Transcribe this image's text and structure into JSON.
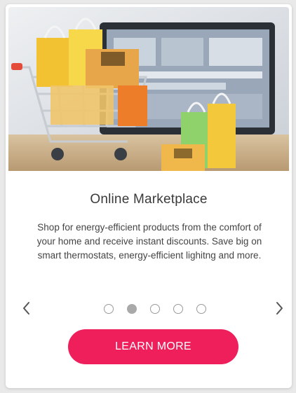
{
  "card": {
    "image": {
      "icon": "shopping-cart-with-bags-and-laptop-photo"
    },
    "title": "Online Marketplace",
    "description": "Shop for energy-efficient products from the comfort of your home and receive instant discounts. Save big on smart thermostats, energy-efficient lighitng and more.",
    "carousel": {
      "prev_icon": "chevron-left-icon",
      "next_icon": "chevron-right-icon",
      "slide_count": 5,
      "active_index": 1
    },
    "cta_label": "LEARN MORE"
  },
  "colors": {
    "accent": "#ee1f5b",
    "background": "#e9e9e9",
    "card": "#ffffff",
    "title_text": "#3a3a3a",
    "body_text": "#444444",
    "dot_active": "#a9a9a9"
  }
}
